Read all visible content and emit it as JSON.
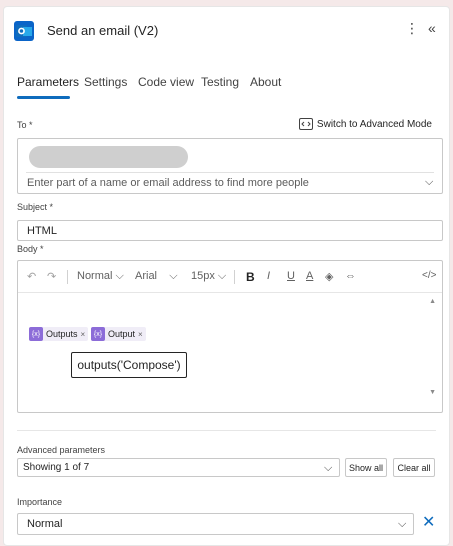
{
  "header": {
    "title": "Send an email (V2)",
    "more_icon": "more-vertical-icon",
    "collapse_icon": "chevrons-left-icon"
  },
  "tabs": [
    {
      "label": "Parameters",
      "active": true
    },
    {
      "label": "Settings",
      "active": false
    },
    {
      "label": "Code view",
      "active": false
    },
    {
      "label": "Testing",
      "active": false
    },
    {
      "label": "About",
      "active": false
    }
  ],
  "to": {
    "label": "To *",
    "advanced_mode": "Switch to Advanced Mode",
    "placeholder": "Enter part of a name or email address to find more people"
  },
  "subject": {
    "label": "Subject *",
    "value": "HTML"
  },
  "body": {
    "label": "Body *",
    "toolbar": {
      "undo": "↶",
      "redo": "↷",
      "style": "Normal",
      "font": "Arial",
      "size": "15px",
      "bold": "B",
      "italic": "I",
      "underline": "U",
      "font_color": "A",
      "highlight": "◈",
      "link": "⇔",
      "code": "</>"
    },
    "tokens": [
      {
        "label": "Outputs",
        "icon": "expression-icon"
      },
      {
        "label": "Output",
        "icon": "expression-icon"
      }
    ],
    "expression": "outputs('Compose')"
  },
  "advanced": {
    "label": "Advanced parameters",
    "value": "Showing 1 of 7",
    "show_all": "Show all",
    "clear_all": "Clear all"
  },
  "importance": {
    "label": "Importance",
    "value": "Normal"
  },
  "colors": {
    "accent": "#0f6cbd",
    "token": "#8c6cd8",
    "app_icon": "#0a64c8",
    "backdrop": "#f5e9e9"
  }
}
